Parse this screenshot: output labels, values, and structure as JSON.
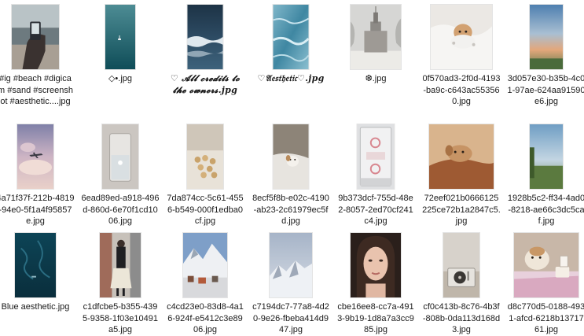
{
  "files": [
    {
      "name": "#ig #beach #digicam #sand #screenshot #aesthetic....jpg",
      "art": "beach-hand-photo"
    },
    {
      "name": "◇•.jpg",
      "art": "teal-sea-boat"
    },
    {
      "name": "♡ 𝓐𝓵𝓵 𝓬𝓻𝓮𝓭𝓲𝓽𝓼 𝓽𝓸 𝓽𝓱𝓮 𝓸𝔀𝓷𝓮𝓻𝓼.jpg",
      "art": "dark-ocean-waves"
    },
    {
      "name": "♡𝔄𝔢𝔰𝔱𝔥𝔢𝔱𝔦𝔠♡.jpg",
      "art": "blue-water-ripples"
    },
    {
      "name": "❆.jpg",
      "art": "snowy-tower"
    },
    {
      "name": "0f570ad3-2f0d-4193-ba9c-c643ac553560.jpg",
      "art": "puppy-in-white-sheets"
    },
    {
      "name": "3d057e30-b35b-4c01-97ae-624aa91590e6.jpg",
      "art": "sunset-sky-field"
    },
    {
      "name": "4a71f37f-212b-4819-94e0-5f1a4f95857e.jpg",
      "art": "airplane-clouds"
    },
    {
      "name": "6ead89ed-a918-496d-860d-6e70f1cd1006.jpg",
      "art": "glass-of-water"
    },
    {
      "name": "7da874cc-5c61-4556-b549-000f1edba0cf.jpg",
      "art": "buttons-on-bed"
    },
    {
      "name": "8ecf5f8b-e02c-4190-ab23-2c61979ec5fd.jpg",
      "art": "small-dog-on-bed"
    },
    {
      "name": "9b373dcf-755d-48e2-8057-2ed70cf241c4.jpg",
      "art": "cassette-tape"
    },
    {
      "name": "72eef021b0666125225ce72b1a2847c5.jpg",
      "art": "puppy-on-brown-pillow"
    },
    {
      "name": "1928b5c2-ff34-4ad0-8218-ae66c3dc5caf.jpg",
      "art": "green-field-sky"
    },
    {
      "name": "Blue aesthetic.jpg",
      "art": "deep-blue-water"
    },
    {
      "name": "c1dfcbe5-b355-4395-9358-1f03e10491a5.jpg",
      "art": "girl-walking-street"
    },
    {
      "name": "c4cd23e0-83d8-4a16-924f-e5412c3e8906.jpg",
      "art": "snowy-mountain-village"
    },
    {
      "name": "c7194dc7-77a8-4d20-9e26-fbeba414d947.jpg",
      "art": "misty-snow-mountains"
    },
    {
      "name": "cbe16ee8-cc7a-4913-9b19-1d8a7a3cc985.jpg",
      "art": "portrait-of-girl"
    },
    {
      "name": "cf0c413b-8c76-4b3f-808b-0da113d168d3.jpg",
      "art": "record-player"
    },
    {
      "name": "d8c770d5-0188-4931-afcd-6218b1371761.jpg",
      "art": "dog-with-cake"
    }
  ]
}
